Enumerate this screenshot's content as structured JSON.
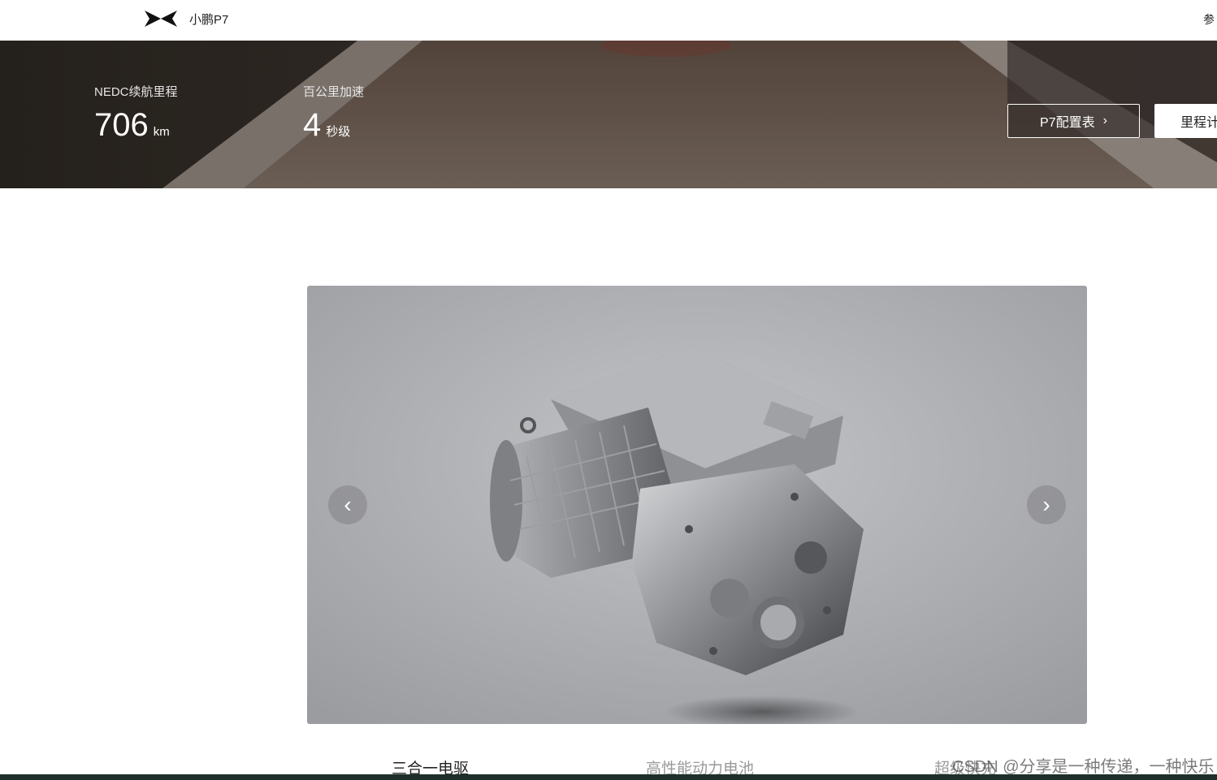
{
  "header": {
    "brand": "小鹏P7",
    "right_partial": "参",
    "logo_icon": "xpeng-x-logo-icon"
  },
  "hero": {
    "stats": [
      {
        "label": "NEDC续航里程",
        "value": "706",
        "unit": "km"
      },
      {
        "label": "百公里加速",
        "value": "4",
        "unit": "秒级"
      }
    ],
    "config_button": "P7配置表",
    "config_button_icon": "chevron-right-icon",
    "range_button": "里程计"
  },
  "carousel": {
    "image": "electric-drive-motor-image",
    "prev_icon": "chevron-left-icon",
    "next_icon": "chevron-right-icon",
    "prev_glyph": "‹",
    "next_glyph": "›"
  },
  "tabs": [
    {
      "label": "三合一电驱",
      "active": true
    },
    {
      "label": "高性能动力电池",
      "active": false
    },
    {
      "label": "超级快充",
      "active": false
    }
  ],
  "watermark": "CSDN @分享是一种传递，一种快乐",
  "colors": {
    "hero_bg": "#3a322c",
    "carousel_bg": "#b3b5b8",
    "text_active": "#222222",
    "text_inactive": "#999999"
  }
}
